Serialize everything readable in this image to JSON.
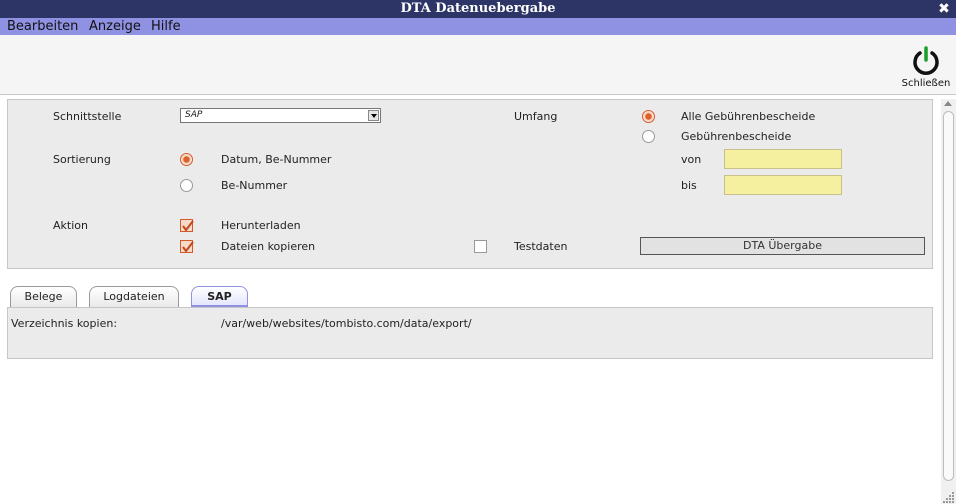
{
  "window": {
    "title": "DTA Datenuebergabe",
    "close_glyph": "✖"
  },
  "menu": {
    "items": [
      "Bearbeiten",
      "Anzeige",
      "Hilfe"
    ]
  },
  "toolbar": {
    "close_label": "Schließen",
    "close_icon": "power-icon"
  },
  "form": {
    "schnittstelle": {
      "label": "Schnittstelle",
      "value": "SAP"
    },
    "sortierung": {
      "label": "Sortierung",
      "options": [
        {
          "label": "Datum, Be-Nummer",
          "selected": true
        },
        {
          "label": "Be-Nummer",
          "selected": false
        }
      ]
    },
    "aktion": {
      "label": "Aktion",
      "options": [
        {
          "label": "Herunterladen",
          "checked": true
        },
        {
          "label": "Dateien kopieren",
          "checked": true
        }
      ]
    },
    "testdaten": {
      "label": "Testdaten",
      "checked": false
    },
    "umfang": {
      "label": "Umfang",
      "options": [
        {
          "label": "Alle Gebührenbescheide",
          "selected": true
        },
        {
          "label": "Gebührenbescheide",
          "selected": false
        }
      ]
    },
    "von": {
      "label": "von",
      "value": ""
    },
    "bis": {
      "label": "bis",
      "value": ""
    },
    "submit_label": "DTA Übergabe"
  },
  "tabs": [
    {
      "label": "Belege",
      "active": false
    },
    {
      "label": "Logdateien",
      "active": false
    },
    {
      "label": "SAP",
      "active": true
    }
  ],
  "sap_tab": {
    "label": "Verzeichnis kopien:",
    "value": "/var/web/websites/tombisto.com/data/export/"
  },
  "colors": {
    "titlebar": "#2d3566",
    "menubar": "#8f92e2",
    "accent": "#d35a2a",
    "input_bg": "#f5f0a0"
  }
}
